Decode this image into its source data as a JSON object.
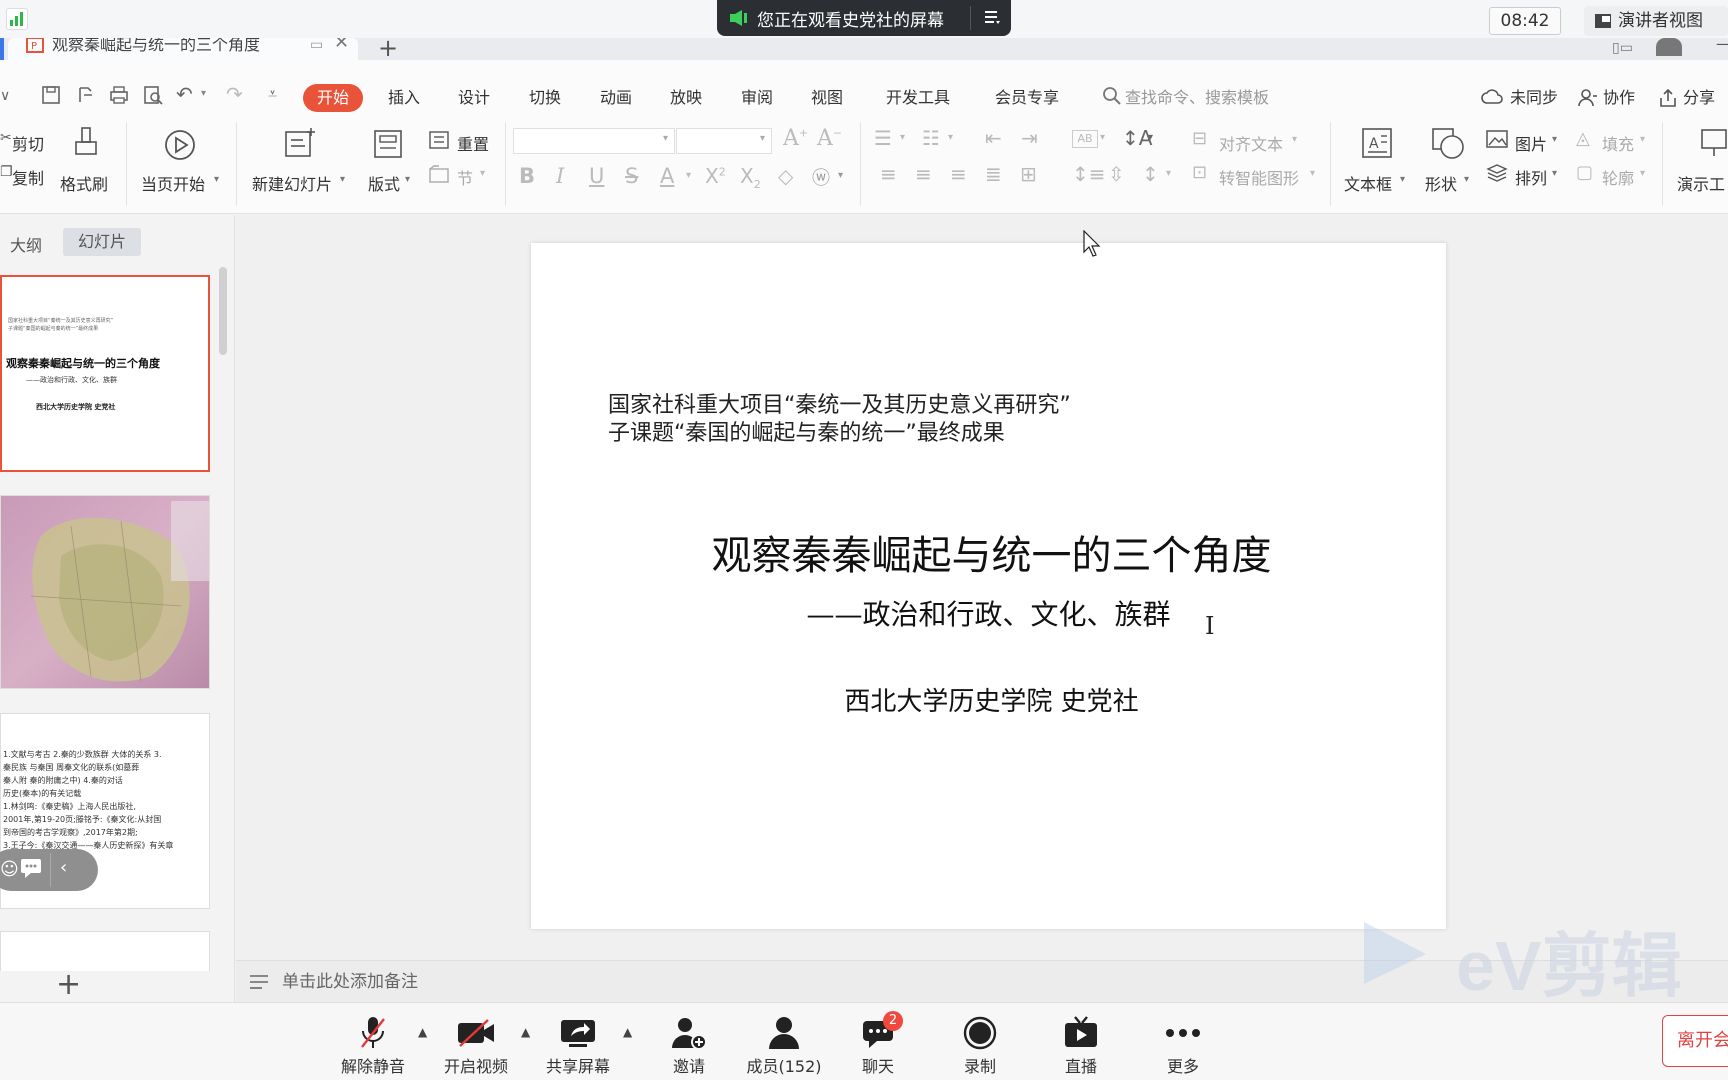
{
  "meeting": {
    "sharing_banner": "您正在观看史党社的屏幕",
    "clock": "08:42",
    "presenter_view": "演讲者视图",
    "bottom": {
      "mute": "解除静音",
      "video": "开启视频",
      "share": "共享屏幕",
      "invite": "邀请",
      "members": "成员(152)",
      "chat": "聊天",
      "chat_badge": "2",
      "record": "录制",
      "live": "直播",
      "more": "更多",
      "leave": "离开会"
    }
  },
  "wps": {
    "doc_title": "观察秦崛起与统一的三个角度",
    "menu": [
      "开始",
      "插入",
      "设计",
      "切换",
      "动画",
      "放映",
      "审阅",
      "视图",
      "开发工具",
      "会员专享"
    ],
    "search_placeholder": "查找命令、搜索模板",
    "right_actions": {
      "sync": "未同步",
      "collab": "协作",
      "share": "分享"
    },
    "ribbon": {
      "cut": "剪切",
      "copy": "复制",
      "format_painter": "格式刷",
      "from_current": "当页开始",
      "new_slide": "新建幻灯片",
      "layout": "版式",
      "reset": "重置",
      "section": "节",
      "align_text": "对齐文本",
      "smart_shape": "转智能图形",
      "textbox": "文本框",
      "shape": "形状",
      "picture": "图片",
      "arrange": "排列",
      "fill": "填充",
      "outline": "轮廓",
      "presentation_tools": "演示工"
    },
    "panel_tabs": {
      "outline": "大纲",
      "slides": "幻灯片"
    },
    "notes_placeholder": "单击此处添加备注",
    "thumb1": {
      "header1": "国家社科重大项目“秦统一及其历史意义再研究”",
      "header2": "子课题“秦国的崛起与秦的统一”最终成果",
      "title": "观察秦秦崛起与统一的三个角度",
      "subtitle": "——政治和行政、文化、族群",
      "author": "西北大学历史学院 史党社"
    },
    "thumb3_lines": [
      "1.文献与考古 2.秦的少数族群 大体的关系 3.",
      "秦民族 与秦国 周秦文化的联系(如墓葬",
      "秦人附 秦的附庸之中) 4.秦的对话",
      "历史(秦本)的有关记载",
      "1.林剑鸣:《秦史稿》上海人民出版社,",
      "2001年,第19-20页;滕铭予:《秦文化:从封国",
      "到帝国的考古学观察》,2017年第2期;",
      "3.王子今:《秦汉交通——秦人历史新探》有关章"
    ],
    "slide": {
      "header1": "国家社科重大项目“秦统一及其历史意义再研究”",
      "header2": "子课题“秦国的崛起与秦的统一”最终成果",
      "title": "观察秦秦崛起与统一的三个角度",
      "subtitle": "——政治和行政、文化、族群",
      "author": "西北大学历史学院  史党社"
    }
  },
  "watermark": "eV剪辑",
  "colors": {
    "accent": "#e8533a",
    "meeting_dark": "#2b2f33",
    "leave_red": "#e04444",
    "badge_red": "#f04a3e"
  }
}
